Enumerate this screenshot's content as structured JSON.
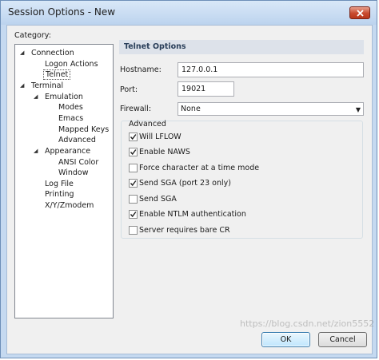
{
  "window": {
    "title": "Session Options - New",
    "close_icon": "close-icon"
  },
  "category_label": "Category:",
  "tree": [
    {
      "label": "Connection",
      "toggle": "◢"
    },
    {
      "label": "Logon Actions",
      "toggle": ""
    },
    {
      "label": "Telnet",
      "toggle": "",
      "selected": true
    },
    {
      "label": "Terminal",
      "toggle": "◢"
    },
    {
      "label": "Emulation",
      "toggle": "◢"
    },
    {
      "label": "Modes",
      "toggle": ""
    },
    {
      "label": "Emacs",
      "toggle": ""
    },
    {
      "label": "Mapped Keys",
      "toggle": ""
    },
    {
      "label": "Advanced",
      "toggle": ""
    },
    {
      "label": "Appearance",
      "toggle": "◢"
    },
    {
      "label": "ANSI Color",
      "toggle": ""
    },
    {
      "label": "Window",
      "toggle": ""
    },
    {
      "label": "Log File",
      "toggle": ""
    },
    {
      "label": "Printing",
      "toggle": ""
    },
    {
      "label": "X/Y/Zmodem",
      "toggle": ""
    }
  ],
  "panel": {
    "header": "Telnet Options",
    "hostname_label": "Hostname:",
    "hostname_value": "127.0.0.1",
    "port_label": "Port:",
    "port_value": "19021",
    "firewall_label": "Firewall:",
    "firewall_value": "None",
    "advanced_title": "Advanced",
    "options": [
      {
        "label": "Will LFLOW",
        "checked": true
      },
      {
        "label": "Enable NAWS",
        "checked": true
      },
      {
        "label": "Force character at a time mode",
        "checked": false
      },
      {
        "label": "Send SGA (port 23 only)",
        "checked": true
      },
      {
        "label": "Send SGA",
        "checked": false
      },
      {
        "label": "Enable NTLM authentication",
        "checked": true
      },
      {
        "label": "Server requires bare CR",
        "checked": false
      }
    ]
  },
  "buttons": {
    "ok": "OK",
    "cancel": "Cancel"
  },
  "watermark": "https://blog.csdn.net/zion5552",
  "colors": {
    "accent": "#3c7fb1",
    "title_bar": "#c5d9f0",
    "close": "#c84a2e"
  }
}
